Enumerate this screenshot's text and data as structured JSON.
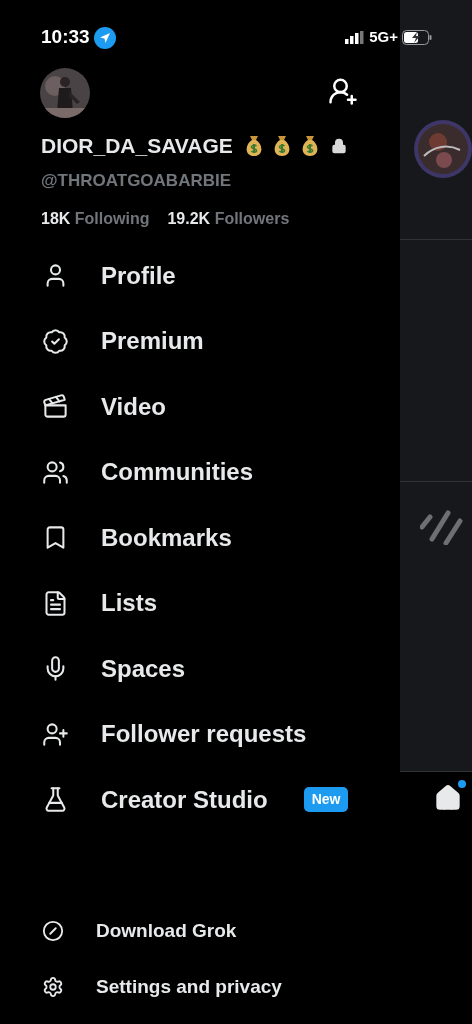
{
  "status_bar": {
    "time": "10:33",
    "network": "5G+"
  },
  "profile": {
    "display_name": "DIOR_DA_SAVAGE",
    "name_badges": [
      {
        "kind": "money_bag"
      },
      {
        "kind": "money_bag"
      },
      {
        "kind": "money_bag"
      },
      {
        "kind": "lock"
      }
    ],
    "handle": "@THROATGOABARBIE",
    "following_count": "18K",
    "following_label": "Following",
    "followers_count": "19.2K",
    "followers_label": "Followers"
  },
  "menu": [
    {
      "kind": "profile",
      "label": "Profile"
    },
    {
      "kind": "premium",
      "label": "Premium"
    },
    {
      "kind": "video",
      "label": "Video"
    },
    {
      "kind": "communities",
      "label": "Communities"
    },
    {
      "kind": "bookmarks",
      "label": "Bookmarks"
    },
    {
      "kind": "lists",
      "label": "Lists"
    },
    {
      "kind": "spaces",
      "label": "Spaces"
    },
    {
      "kind": "follower_requests",
      "label": "Follower requests"
    },
    {
      "kind": "creator_studio",
      "label": "Creator Studio",
      "badge": "New"
    }
  ],
  "footer": [
    {
      "kind": "grok",
      "label": "Download Grok"
    },
    {
      "kind": "settings",
      "label": "Settings and privacy"
    }
  ],
  "background": {
    "home_notification": true
  }
}
